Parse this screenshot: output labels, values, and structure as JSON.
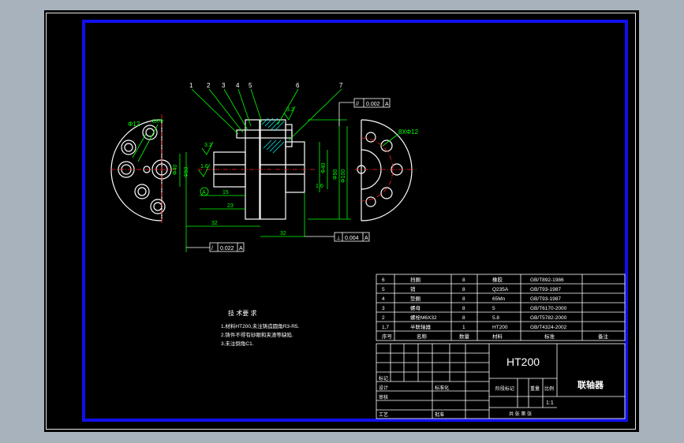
{
  "colors": {
    "background": "#a7b2bd",
    "sheet": "#000000",
    "border": "#1010ee",
    "geometry": "#ffffff",
    "dimension": "#00ff00",
    "leader": "#00ff00",
    "hatch": "#00ffff",
    "center": "#ff2020",
    "text": "#ffffff"
  },
  "part_labels": [
    "1",
    "2",
    "3",
    "4",
    "5",
    "6",
    "7"
  ],
  "dims": {
    "d1": "15",
    "d2": "23",
    "d3": "32",
    "d4": "32",
    "vert1": "Φ40",
    "vert2": "Φ50",
    "vert3": "Φ90",
    "vert4": "Φ100",
    "vert5": "Φ40",
    "rough1": "3.2",
    "rough2": "3.2",
    "rough3": "1.6",
    "rough4": "1.6",
    "left_note1": "Φ12",
    "left_note2": "8XΦ",
    "right_note": "8XΦ12",
    "datum": "A"
  },
  "tolerances": {
    "top": {
      "sym": "//",
      "val": "0.002",
      "ref": "A"
    },
    "bottom_right": {
      "sym": "⊥",
      "val": "0.004",
      "ref": "A"
    },
    "bottom_left": {
      "sym": "/",
      "val": "0.022",
      "ref": "A"
    }
  },
  "tech": {
    "title": "技 术要 求",
    "lines": [
      "1.材料HT200,未注铸造圆角R3-R5.",
      "2.铸件不得有砂眼和夹渣等缺陷.",
      "3.未注倒角C1."
    ]
  },
  "bom": [
    {
      "no": "6",
      "name": "挡圈",
      "qty": "8",
      "mat": "橡胶",
      "std": "GB/T892-1986"
    },
    {
      "no": "5",
      "name": "销",
      "qty": "8",
      "mat": "Q235A",
      "std": "GB/T93-1987"
    },
    {
      "no": "4",
      "name": "垫圈",
      "qty": "8",
      "mat": "65Mn",
      "std": "GB/T93-1987"
    },
    {
      "no": "3",
      "name": "螺母",
      "qty": "8",
      "mat": "5",
      "std": "GB/T6170-2000"
    },
    {
      "no": "2",
      "name": "螺栓M6X32",
      "qty": "8",
      "mat": "5.8",
      "std": "GB/T5782-2000"
    },
    {
      "no": "1,7",
      "name": "半联轴器",
      "qty": "1",
      "mat": "HT200",
      "std": "GB/T4324-2002"
    }
  ],
  "bom_header": {
    "no": "序号",
    "name": "名称",
    "qty": "数量",
    "mat": "材料",
    "std": "标准",
    "note": "备注"
  },
  "title_block": {
    "material": "HT200",
    "name": "联轴器",
    "scale": "1:1",
    "labels": {
      "mark": "标记",
      "design": "设计",
      "std": "标准化",
      "check": "审核",
      "craft": "工艺",
      "approve": "批准",
      "stage": "阶段标记",
      "weight": "重量",
      "ratio": "比例",
      "sheet": "共 张 第 张"
    }
  }
}
